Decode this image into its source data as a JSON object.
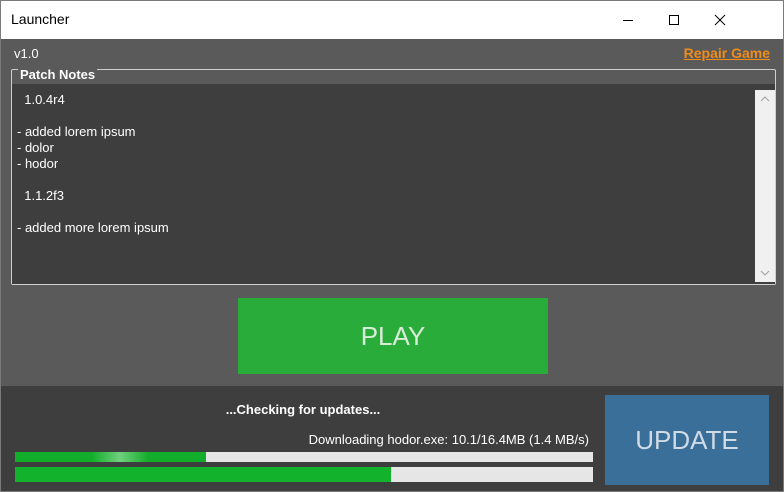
{
  "window": {
    "title": "Launcher",
    "icons": {
      "minimize": "minimize-icon",
      "maximize": "maximize-icon",
      "close": "close-icon"
    }
  },
  "header": {
    "version": "v1.0",
    "repair_label": "Repair Game"
  },
  "patch_notes": {
    "legend": "Patch Notes",
    "content": "  1.0.4r4\n\n- added lorem ipsum\n- dolor\n- hodor\n\n  1.1.2f3\n\n- added more lorem ipsum"
  },
  "play": {
    "label": "PLAY"
  },
  "updater": {
    "status": "...Checking for updates...",
    "download_text": "Downloading hodor.exe: 10.1/16.4MB (1.4 MB/s)",
    "file_progress": 0.33,
    "total_progress": 0.65,
    "update_label": "UPDATE"
  },
  "colors": {
    "accent_orange": "#f08c1a",
    "play_green": "#2aac3a",
    "progress_green": "#13b22c",
    "update_blue": "#3a6f99"
  }
}
